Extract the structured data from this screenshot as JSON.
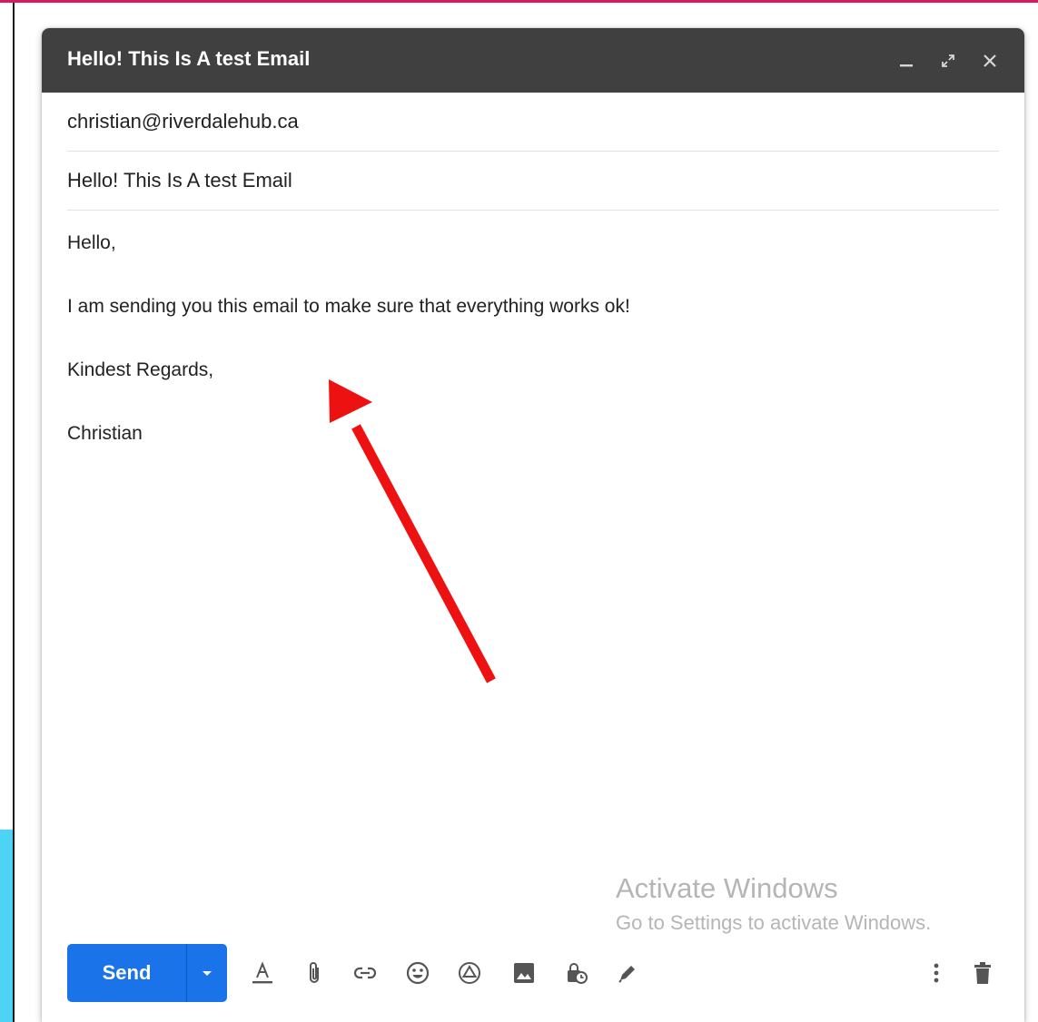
{
  "compose": {
    "title": "Hello! This Is A test Email",
    "to": "christian@riverdalehub.ca",
    "subject": "Hello! This Is A test Email",
    "body_lines": [
      "Hello,",
      "I am sending you this email to make sure that everything works ok!",
      "Kindest Regards,",
      "Christian"
    ],
    "send_label": "Send"
  },
  "watermark": {
    "line1": "Activate Windows",
    "line2": "Go to Settings to activate Windows."
  },
  "titlebar_icons": [
    "minimize-icon",
    "expand-icon",
    "close-icon"
  ],
  "toolbar_icons": [
    "formatting-icon",
    "attach-icon",
    "link-icon",
    "emoji-icon",
    "drive-icon",
    "photo-icon",
    "confidential-icon",
    "signature-icon",
    "more-options-icon",
    "delete-icon"
  ],
  "colors": {
    "titlebar": "#404040",
    "send_button": "#1a73e8",
    "annotation_arrow": "#ee1111",
    "pink_border": "#d81b60",
    "cyan_strip": "#4dd4f4"
  }
}
